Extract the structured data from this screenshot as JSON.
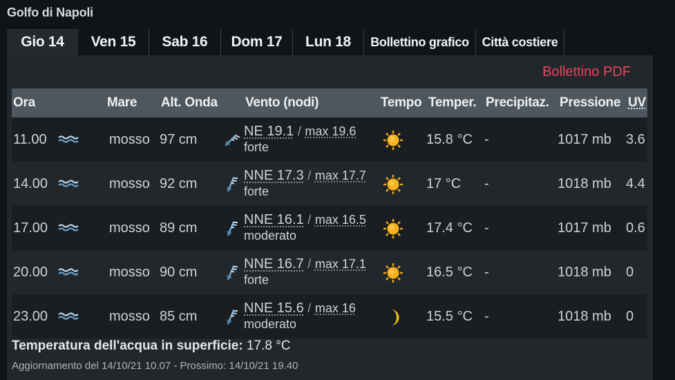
{
  "title": "Golfo di Napoli",
  "tabs": [
    "Gio 14",
    "Ven 15",
    "Sab 16",
    "Dom 17",
    "Lun 18",
    "Bollettino grafico",
    "Città costiere"
  ],
  "pdf_link": "Bollettino PDF",
  "headers": {
    "ora": "Ora",
    "mare": "Mare",
    "onda": "Alt. Onda",
    "vento": "Vento (nodi)",
    "tempo": "Tempo",
    "temper": "Temper.",
    "precip": "Precipitaz.",
    "pressione": "Pressione",
    "uv": "UV"
  },
  "rows": [
    {
      "ora": "11.00",
      "mare": "mosso",
      "onda": "97 cm",
      "wind_dir": "NE",
      "wind": "NE 19.1",
      "sep": "/",
      "max": "max 19.6",
      "level": "forte",
      "weather_icon": "sun-icon",
      "temp": "15.8 °C",
      "precip": "-",
      "pressione": "1017 mb",
      "uv": "3.6"
    },
    {
      "ora": "14.00",
      "mare": "mosso",
      "onda": "92 cm",
      "wind_dir": "NNE",
      "wind": "NNE 17.3",
      "sep": "/",
      "max": "max 17.7",
      "level": "forte",
      "weather_icon": "sun-icon",
      "temp": "17 °C",
      "precip": "-",
      "pressione": "1018 mb",
      "uv": "4.4"
    },
    {
      "ora": "17.00",
      "mare": "mosso",
      "onda": "89 cm",
      "wind_dir": "NNE",
      "wind": "NNE 16.1",
      "sep": "/",
      "max": "max 16.5",
      "level": "moderato",
      "weather_icon": "sun-icon",
      "temp": "17.4 °C",
      "precip": "-",
      "pressione": "1017 mb",
      "uv": "0.6"
    },
    {
      "ora": "20.00",
      "mare": "mosso",
      "onda": "90 cm",
      "wind_dir": "NNE",
      "wind": "NNE 16.7",
      "sep": "/",
      "max": "max 17.1",
      "level": "forte",
      "weather_icon": "sun-icon",
      "temp": "16.5 °C",
      "precip": "-",
      "pressione": "1018 mb",
      "uv": "0"
    },
    {
      "ora": "23.00",
      "mare": "mosso",
      "onda": "85 cm",
      "wind_dir": "NNE",
      "wind": "NNE 15.6",
      "sep": "/",
      "max": "max 16",
      "level": "moderato",
      "weather_icon": "moon-icon",
      "temp": "15.5 °C",
      "precip": "-",
      "pressione": "1018 mb",
      "uv": "0"
    }
  ],
  "footer": {
    "water_label": "Temperatura dell'acqua in superficie:",
    "water_value": "17.8 °C",
    "update": "Aggiornamento del 14/10/21 10.07 - Prossimo: 14/10/21 19.40"
  },
  "colors": {
    "accent": "#e8455c",
    "header_bg": "#4f575e",
    "panel_bg": "#22272b",
    "sun": "#f2a81d",
    "moon": "#f2c21d"
  }
}
